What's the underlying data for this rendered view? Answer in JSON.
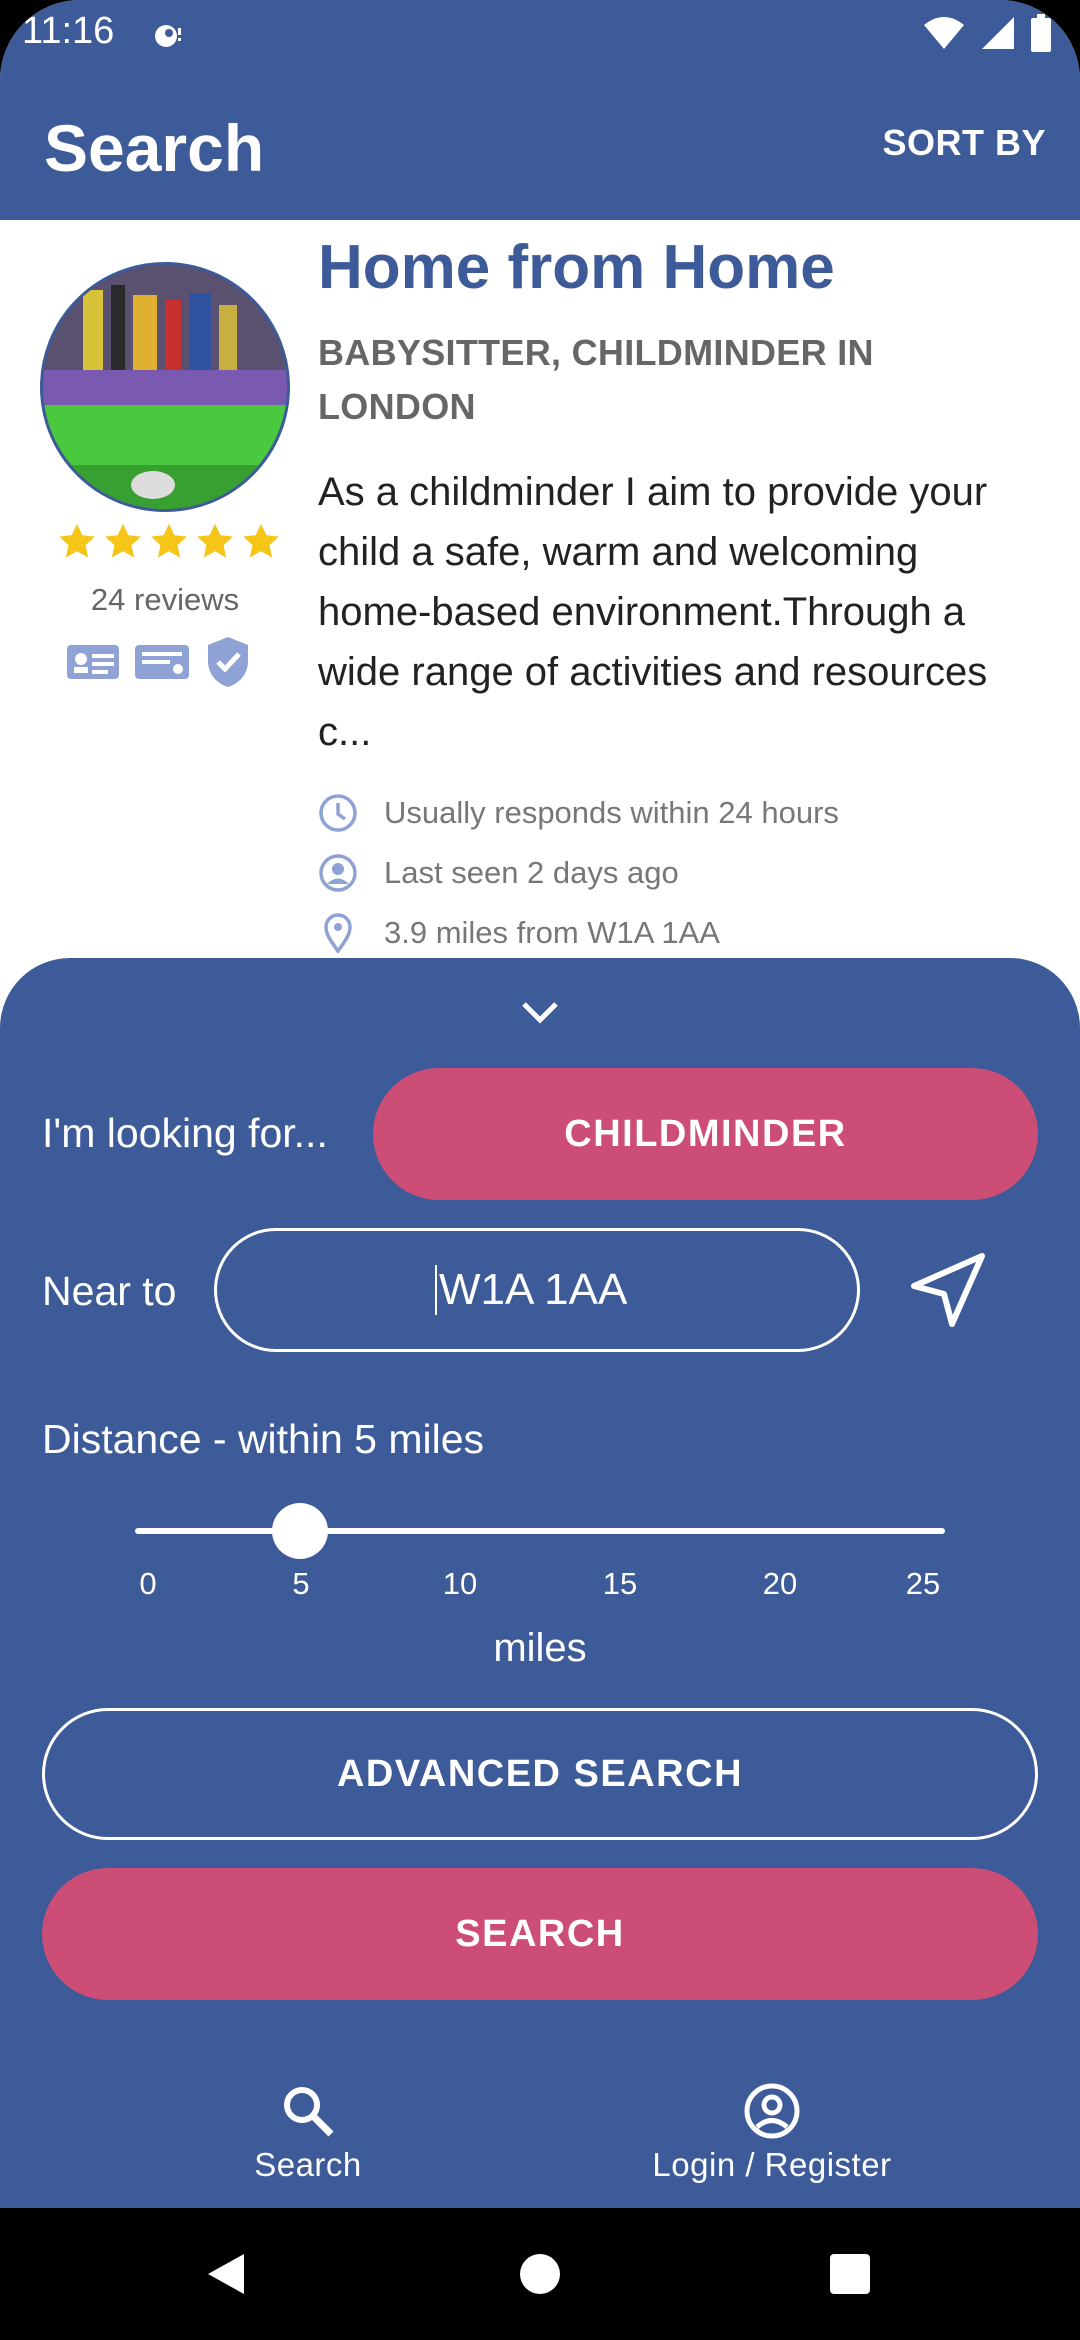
{
  "status_bar": {
    "time": "11:16"
  },
  "appbar": {
    "title": "Search",
    "sort_label": "SORT BY"
  },
  "listing": {
    "name": "Home from Home",
    "category": "BABYSITTER, CHILDMINDER IN LONDON",
    "description": "As a childminder I aim to provide your child a safe, warm and welcoming home-based environment.Through a wide range of activities and resources c...",
    "rating": 5,
    "reviews": "24 reviews",
    "meta": [
      {
        "icon": "clock-icon",
        "text": "Usually responds within 24 hours"
      },
      {
        "icon": "person-icon",
        "text": "Last seen 2 days ago"
      },
      {
        "icon": "location-pin-icon",
        "text": "3.9 miles from W1A 1AA"
      }
    ]
  },
  "search_sheet": {
    "looking_label": "I'm looking for...",
    "looking_value": "CHILDMINDER",
    "near_label": "Near to",
    "near_value": "W1A 1AA",
    "distance_label": "Distance - within 5 miles",
    "slider_value": 5,
    "slider_ticks": [
      "0",
      "5",
      "10",
      "15",
      "20",
      "25"
    ],
    "slider_unit": "miles",
    "advanced_label": "ADVANCED SEARCH",
    "search_label": "SEARCH"
  },
  "bottom_nav": [
    {
      "icon": "search-icon",
      "label": "Search"
    },
    {
      "icon": "account-circle-icon",
      "label": "Login / Register"
    }
  ],
  "colors": {
    "primary": "#3d5a99",
    "accent": "#cc4e76",
    "star": "#f5c518"
  }
}
